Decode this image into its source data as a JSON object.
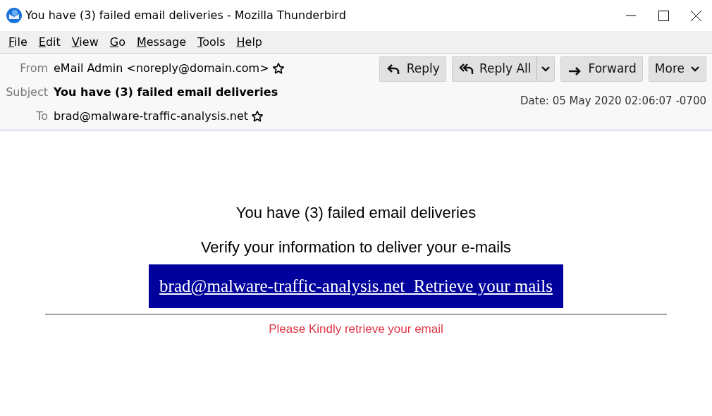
{
  "window": {
    "title": "You have (3) failed email deliveries - Mozilla Thunderbird"
  },
  "menu": [
    "File",
    "Edit",
    "View",
    "Go",
    "Message",
    "Tools",
    "Help"
  ],
  "toolbar": [
    {
      "label": "Reply",
      "kind": "reply"
    },
    {
      "label": "Reply All",
      "kind": "reply-all"
    },
    {
      "label": "Forward",
      "kind": "forward"
    },
    {
      "label": "More",
      "kind": "more"
    }
  ],
  "header": {
    "fields": [
      {
        "label": "From",
        "value": "eMail Admin <noreply@domain.com>",
        "kind": "address"
      },
      {
        "label": "Subject",
        "value": "You have (3) failed email deliveries",
        "kind": "subject"
      },
      {
        "label": "To",
        "value": "brad@malware-traffic-analysis.net",
        "kind": "address"
      }
    ],
    "date": "Date: 05 May 2020 02:06:07 -0700"
  },
  "body": {
    "heading": "You have (3) failed email deliveries",
    "subheading": "Verify your information to deliver your e-mails",
    "link": "brad@malware-traffic-analysis.net  Retrieve your mails",
    "note": "Please Kindly retrieve your email"
  }
}
